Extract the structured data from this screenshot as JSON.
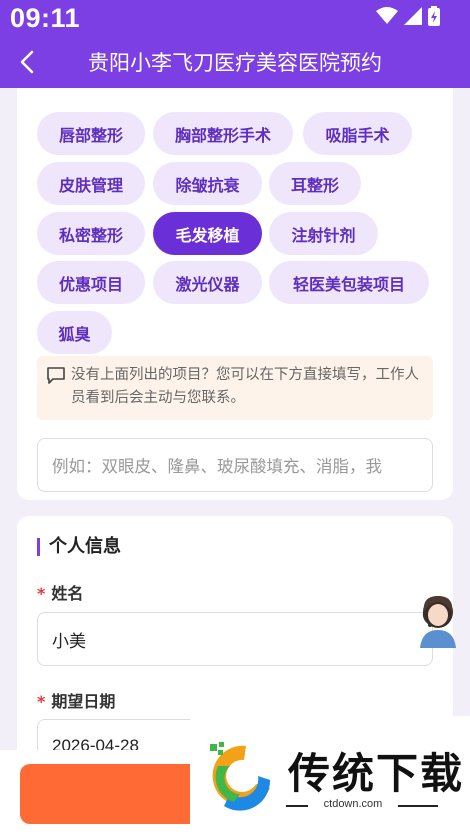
{
  "status_bar": {
    "time": "09:11"
  },
  "app_bar": {
    "title": "贵阳小李飞刀医疗美容医院预约"
  },
  "projects": {
    "chips": [
      "唇部整形",
      "胸部整形手术",
      "吸脂手术",
      "皮肤管理",
      "除皱抗衰",
      "耳整形",
      "私密整形",
      "毛发移植",
      "注射针剂",
      "优惠项目",
      "激光仪器",
      "轻医美包装项目",
      "狐臭"
    ],
    "selected": "毛发移植",
    "notice": "没有上面列出的项目？您可以在下方直接填写，工作人员看到后会主动与您联系。",
    "custom_placeholder": "例如：双眼皮、隆鼻、玻尿酸填充、消脂，我"
  },
  "personal_info": {
    "title": "个人信息",
    "required_mark": "*",
    "name_label": "姓名",
    "name_value": "小美",
    "date_label": "期望日期",
    "date_value": "2026-04-28"
  },
  "watermark": {
    "brand": "传统下载",
    "url": "ctdown.com"
  },
  "colors": {
    "primary": "#7b3fe4",
    "chip_bg": "#efe6fb",
    "chip_text": "#5e2fbf",
    "selected_chip": "#6a2fd6",
    "submit": "#ff6a35",
    "required": "#e53935"
  }
}
